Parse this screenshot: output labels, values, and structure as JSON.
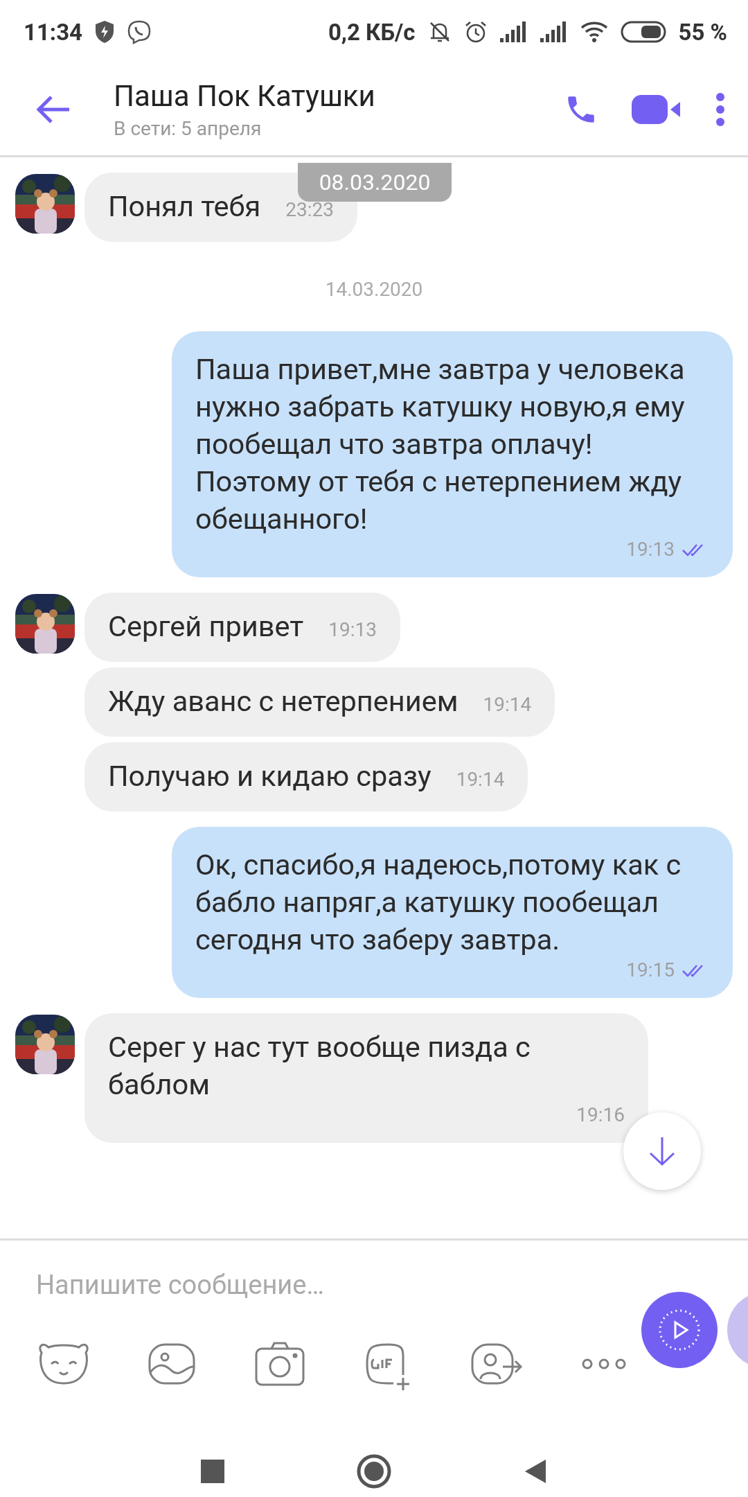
{
  "status_bar": {
    "time": "11:34",
    "speed": "0,2 КБ/с",
    "battery": "55 %"
  },
  "header": {
    "title": "Паша Пок Катушки",
    "subtitle": "В сети: 5 апреля"
  },
  "floating_date": "08.03.2020",
  "messages": [
    {
      "kind": "incoming",
      "avatar": true,
      "text": "Понял тебя",
      "time": "23:23"
    },
    {
      "kind": "date",
      "text": "14.03.2020"
    },
    {
      "kind": "outgoing",
      "text": "Паша привет,мне завтра у человека нужно забрать катушку новую,я ему пообещал что завтра оплачу!\nПоэтому от тебя с нетерпением жду обещанного!",
      "time": "19:13",
      "read": true
    },
    {
      "kind": "incoming",
      "avatar": true,
      "text": "Сергей привет",
      "time": "19:13"
    },
    {
      "kind": "incoming",
      "avatar": false,
      "text": "Жду аванс с нетерпением",
      "time": "19:14"
    },
    {
      "kind": "incoming",
      "avatar": false,
      "text": "Получаю и кидаю сразу",
      "time": "19:14"
    },
    {
      "kind": "outgoing",
      "text": "Ок, спасибо,я надеюсь,потому как с бабло напряг,а катушку пообещал сегодня что заберу завтра.",
      "time": "19:15",
      "read": true
    },
    {
      "kind": "incoming",
      "avatar": true,
      "text": "Серег у нас тут вообще пизда с баблом",
      "time": "19:16"
    }
  ],
  "composer": {
    "placeholder": "Напишите сообщение…"
  }
}
